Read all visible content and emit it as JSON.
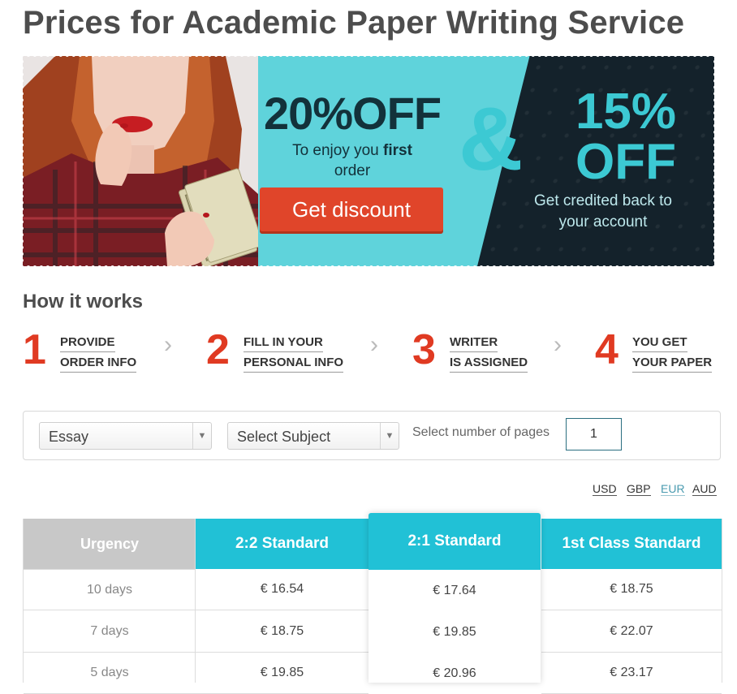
{
  "page": {
    "title": "Prices for Academic Paper Writing Service"
  },
  "banner": {
    "offer1_headline": "20%OFF",
    "offer1_line1": "To enjoy you ",
    "offer1_bold": "first",
    "offer1_line2": "order",
    "button_label": "Get discount",
    "ampersand": "&",
    "offer2_headline1": "15%",
    "offer2_headline2": "OFF",
    "offer2_line1": "Get credited back to",
    "offer2_line2": "your account"
  },
  "how_it_works": {
    "title": "How it works",
    "steps": [
      {
        "num": "1",
        "line1": "PROVIDE",
        "line2": "ORDER INFO"
      },
      {
        "num": "2",
        "line1": "FILL IN YOUR",
        "line2": "PERSONAL INFO"
      },
      {
        "num": "3",
        "line1": "WRITER",
        "line2": "IS ASSIGNED"
      },
      {
        "num": "4",
        "line1": "YOU GET",
        "line2": "YOUR PAPER"
      }
    ],
    "arrow_glyph": "›"
  },
  "calculator": {
    "paper_type": "Essay",
    "subject": "Select Subject",
    "pages_label": "Select number of pages",
    "pages_value": "1"
  },
  "currencies": [
    "USD",
    "GBP",
    "EUR",
    "AUD"
  ],
  "active_currency": "EUR",
  "price_table": {
    "columns": [
      {
        "label": "Urgency",
        "color": "#c8c8c8"
      },
      {
        "label": "2:2 Standard",
        "color": "#21c1d6"
      },
      {
        "label": "2:1 Standard",
        "color": "#21c1d6"
      },
      {
        "label": "1st Class Standard",
        "color": "#21c1d6"
      }
    ],
    "rows": [
      [
        "10 days",
        "€ 16.54",
        "€ 17.64",
        "€ 18.75"
      ],
      [
        "7 days",
        "€ 18.75",
        "€ 19.85",
        "€ 22.07"
      ],
      [
        "5 days",
        "€ 19.85",
        "€ 20.96",
        "€ 23.17"
      ]
    ]
  },
  "colors": {
    "accent_red": "#e03a22",
    "accent_teal": "#21c1d6",
    "banner_teal": "#5fd3db",
    "banner_dark": "#14222b"
  }
}
